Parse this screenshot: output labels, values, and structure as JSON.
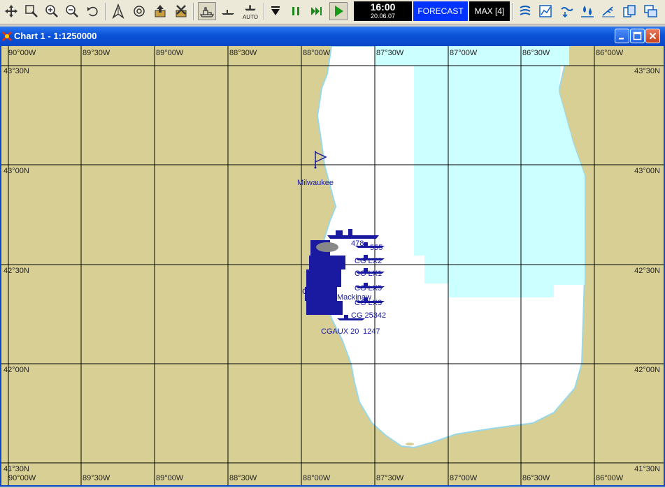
{
  "toolbar": {
    "clock_time": "16:00",
    "clock_date": "20.06.07",
    "forecast_label": "FORECAST",
    "max_label": "MAX [4]",
    "auto_label": "AUTO"
  },
  "window": {
    "title": "Chart 1 - 1:1250000"
  },
  "chart": {
    "lon_labels": [
      "90°00W",
      "89°30W",
      "89°00W",
      "88°30W",
      "88°00W",
      "87°30W",
      "87°00W",
      "86°30W",
      "86°00W"
    ],
    "lat_labels": [
      "43°30N",
      "43°00N",
      "42°30N",
      "42°00N",
      "41°30N"
    ],
    "place_name": "Milwaukee",
    "colors": {
      "land": "#d8cf94",
      "water": "#ffffff",
      "shallow": "#ccffff",
      "grid": "#000000",
      "vessel": "#1a1aa0"
    },
    "vessel_labels": [
      "478",
      "555",
      "CG LX2",
      "CG LX1",
      "CG LX5",
      "CG LX3",
      "CG 25342",
      "Mackinaw",
      "CGAUX 20",
      "1247",
      "CG"
    ]
  }
}
